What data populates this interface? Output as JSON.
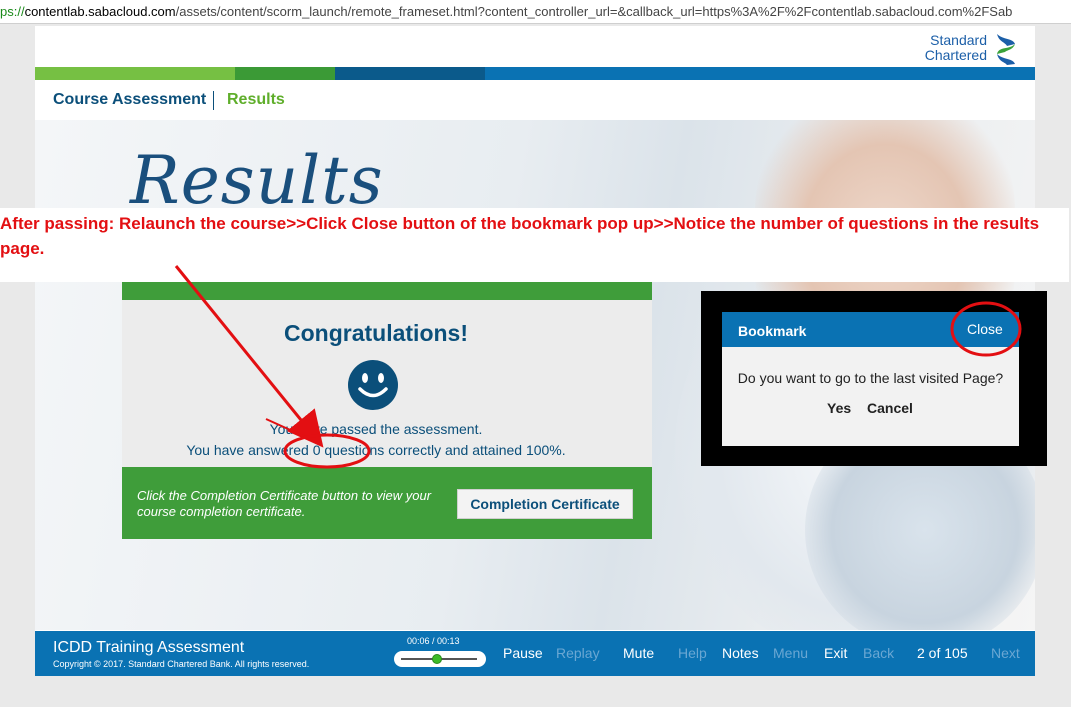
{
  "browser": {
    "url_prefix": "ps://",
    "url_host": "contentlab.sabacloud.com",
    "url_rest": "/assets/content/scorm_launch/remote_frameset.html?content_controller_url=&callback_url=https%3A%2F%2Fcontentlab.sabacloud.com%2FSab"
  },
  "brand": {
    "line1": "Standard",
    "line2": "Chartered"
  },
  "stripe_colors": [
    "#76c043",
    "#3b9a36",
    "#0b5a8b",
    "#0a72b3",
    "#1aa3dc",
    "#0a72b3"
  ],
  "nav": {
    "course_label": "Course Assessment",
    "results_label": "Results"
  },
  "hero": {
    "heading": "Results"
  },
  "annotation": {
    "note": "After passing: Relaunch the course>>Click Close button of the bookmark pop up>>Notice the number of questions in the results page.",
    "color": "#e30f12"
  },
  "card": {
    "heading": "Congratulations!",
    "line1": "You have passed the assessment.",
    "line2": "You have answered 0 questions correctly and attained 100%.",
    "cert_text": "Click the Completion Certificate button to view your course completion certificate.",
    "cert_button": "Completion Certificate"
  },
  "bookmark": {
    "title": "Bookmark",
    "close_label": "Close",
    "question": "Do you want to go to the last visited Page?",
    "yes_label": "Yes",
    "cancel_label": "Cancel"
  },
  "footer": {
    "title": "ICDD Training Assessment",
    "copyright": "Copyright © 2017. Standard Chartered Bank. All rights reserved.",
    "time": "00:06 / 00:13",
    "progress": 0.46,
    "buttons": {
      "pause": "Pause",
      "replay": "Replay",
      "mute": "Mute",
      "help": "Help",
      "notes": "Notes",
      "menu": "Menu",
      "exit": "Exit",
      "back": "Back",
      "next": "Next"
    },
    "page_counter": "2 of 105"
  },
  "icons": {
    "smiley": "smiley-icon",
    "logo": "standard-chartered-logo-icon"
  }
}
